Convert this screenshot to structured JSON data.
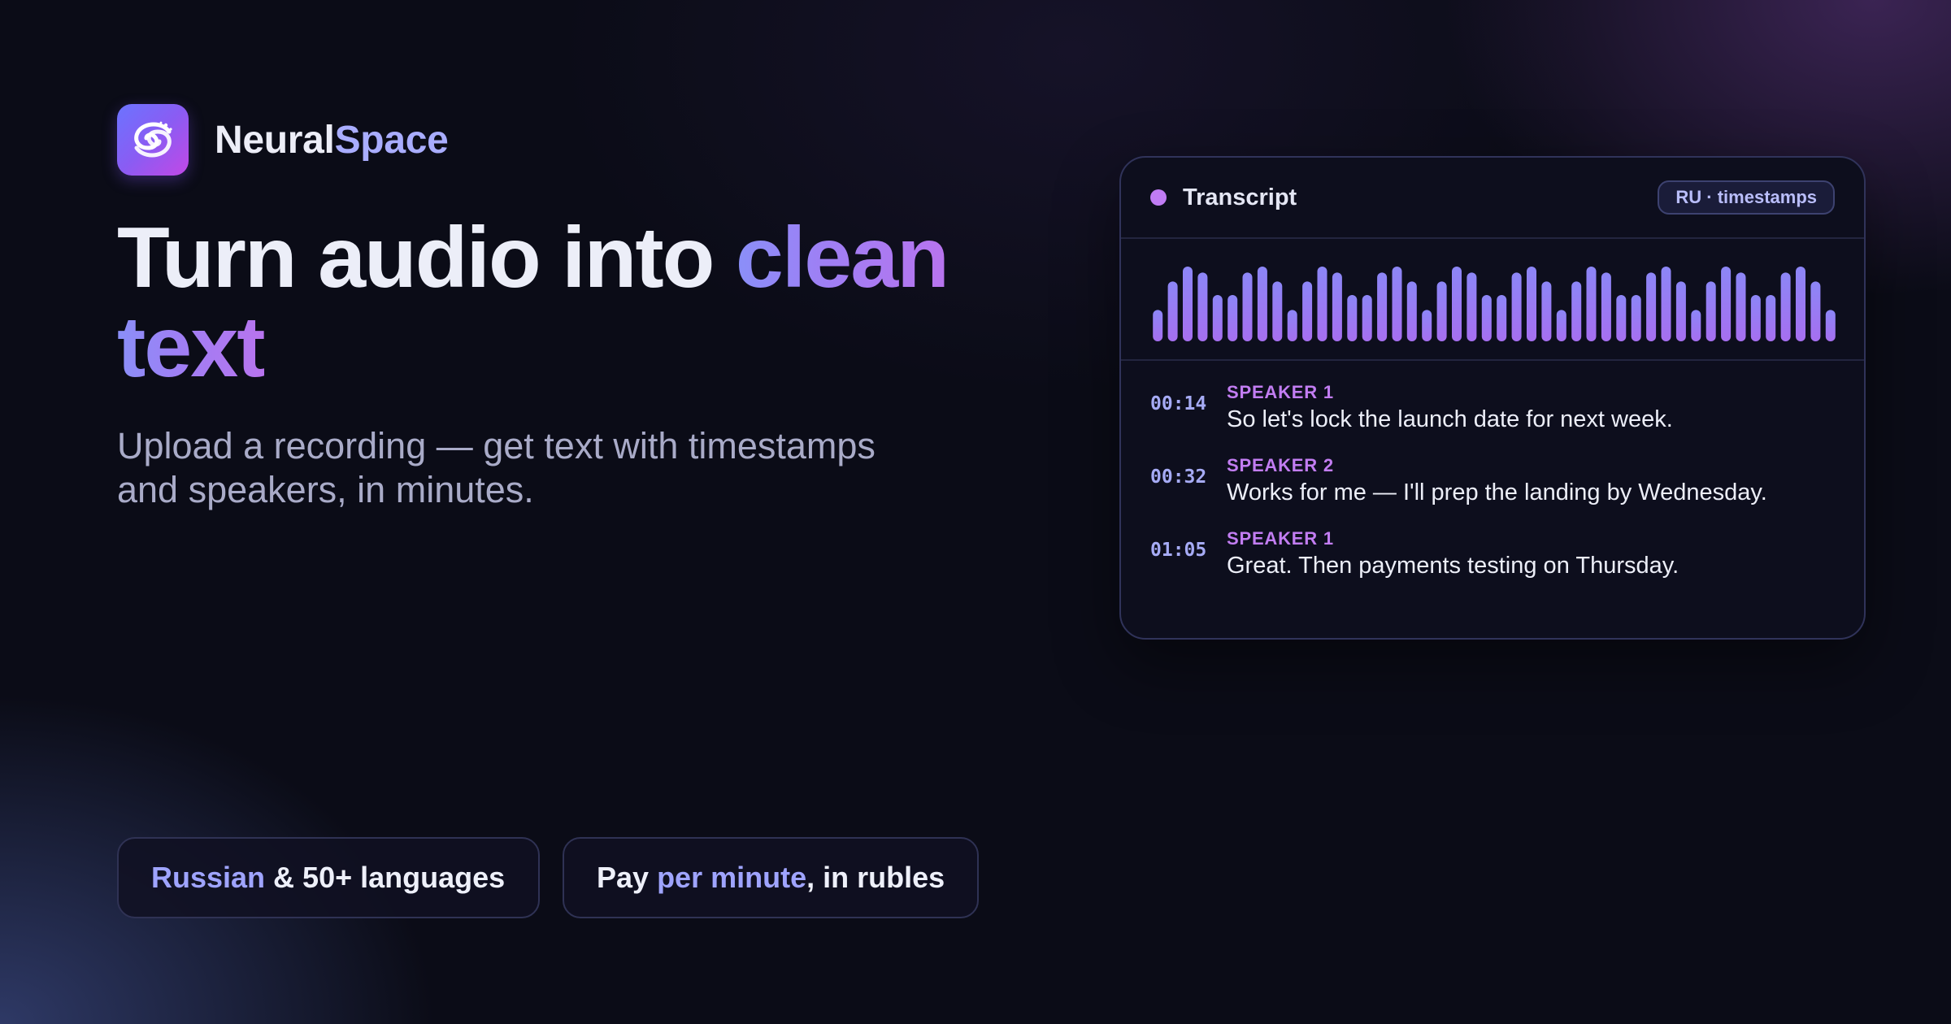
{
  "brand": {
    "name_part1": "Neural",
    "name_part2": "Space",
    "logo_icon": "galaxy-swirl-icon"
  },
  "hero": {
    "headline_plain": "Turn audio into ",
    "headline_accent_1": "clean",
    "headline_accent_2": "text",
    "subtitle": "Upload a recording — get text with timestamps and speakers, in minutes."
  },
  "chips": [
    {
      "accent": "Russian",
      "rest": " & 50+ languages"
    },
    {
      "prefix": "Pay ",
      "accent": "per minute",
      "suffix": ", in rubles"
    }
  ],
  "transcript_card": {
    "title": "Transcript",
    "badge": "RU · timestamps",
    "waveform_icon": "audio-waveform",
    "waveform_levels": [
      0.42,
      0.8,
      1,
      0.92,
      0.62,
      0.62,
      0.92,
      1,
      0.8,
      0.42,
      0.8,
      1,
      0.92,
      0.62,
      0.62,
      0.92,
      1,
      0.8,
      0.42,
      0.8,
      1,
      0.92,
      0.62,
      0.62,
      0.92,
      1,
      0.8,
      0.42,
      0.8,
      1,
      0.92,
      0.62,
      0.62,
      0.92,
      1,
      0.8,
      0.42,
      0.8,
      1,
      0.92,
      0.62,
      0.62,
      0.92,
      1,
      0.8,
      0.42
    ],
    "lines": [
      {
        "time": "00:14",
        "speaker": "SPEAKER 1",
        "text": "So let's lock the launch date for next week."
      },
      {
        "time": "00:32",
        "speaker": "SPEAKER 2",
        "text": "Works for me — I'll prep the landing by Wednesday."
      },
      {
        "time": "01:05",
        "speaker": "SPEAKER 1",
        "text": "Great. Then payments testing on Thursday."
      }
    ]
  },
  "colors": {
    "background": "#0b0c17",
    "accent_blue": "#9fa4ff",
    "accent_purple": "#c07cf4",
    "card_bg": "#0d0e1d"
  }
}
